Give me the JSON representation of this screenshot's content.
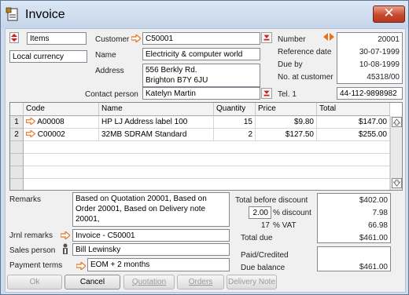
{
  "window": {
    "title": "Invoice",
    "close_glyph": "✕"
  },
  "top_left": {
    "items_label": "Items",
    "currency": "Local currency"
  },
  "customer": {
    "label": "Customer",
    "code": "C50001",
    "name_label": "Name",
    "name": "Electricity & computer world",
    "address_label": "Address",
    "address_line1": "556 Berkly Rd.",
    "address_line2": "Brighton B7Y 6JU",
    "contact_label": "Contact person",
    "contact": "Katelyn Martin"
  },
  "meta": {
    "number_label": "Number",
    "number": "20001",
    "refdate_label": "Reference date",
    "refdate": "30-07-1999",
    "due_label": "Due by",
    "due": "10-08-1999",
    "nocust_label": "No. at customer",
    "nocust": "45318/00",
    "tel_label": "Tel. 1",
    "tel": "44-112-9898982"
  },
  "table": {
    "columns": [
      "Code",
      "Name",
      "Quantity",
      "Price",
      "Total"
    ],
    "rows": [
      {
        "num": "1",
        "code": "A00008",
        "name": "HP LJ Address label 100",
        "qty": "15",
        "price": "$9.80",
        "total": "$147.00"
      },
      {
        "num": "2",
        "code": "C00002",
        "name": "32MB SDRAM Standard",
        "qty": "2",
        "price": "$127.50",
        "total": "$255.00"
      }
    ]
  },
  "remarks": {
    "label": "Remarks",
    "line1": "Based on Quotation 20001, Based on",
    "line2": "Order 20001, Based on Delivery note",
    "line3": "20001,"
  },
  "jrnl": {
    "label": "Jrnl remarks",
    "value": "Invoice - C50001"
  },
  "salesperson": {
    "label": "Sales person",
    "value": "Bill Lewinsky"
  },
  "terms": {
    "label": "Payment terms",
    "value": "EOM + 2 months"
  },
  "totals": {
    "before_label": "Total before discount",
    "before": "$402.00",
    "discount_pct": "2.00",
    "discount_label": "% discount",
    "discount": "7.98",
    "vat_pct": "17",
    "vat_label": "% VAT",
    "vat": "66.98",
    "due_label": "Total due",
    "due": "$461.00",
    "paid_label": "Paid/Credited",
    "balance_label": "Due balance",
    "balance": "$461.00"
  },
  "buttons": {
    "ok": "Ok",
    "cancel": "Cancel",
    "quotation": "Quotation",
    "orders": "Orders",
    "delivery": "Delivery Note"
  },
  "colors": {
    "arrow": "#e8731c",
    "dd_red": "#cc1e1e",
    "close_red": "#c74a2e"
  }
}
